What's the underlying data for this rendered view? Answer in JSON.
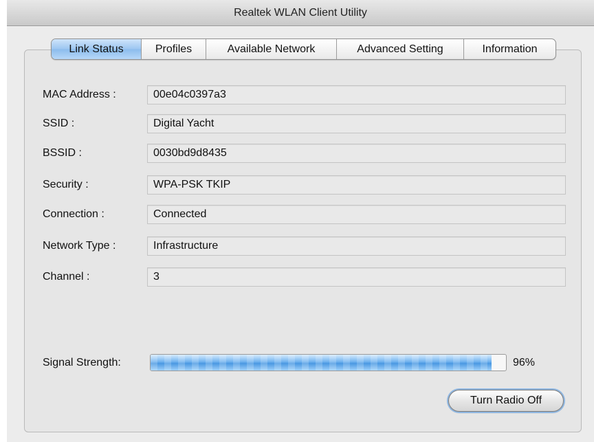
{
  "window": {
    "title": "Realtek WLAN Client Utility"
  },
  "tabs": [
    {
      "label": "Link Status",
      "active": true
    },
    {
      "label": "Profiles",
      "active": false
    },
    {
      "label": "Available Network",
      "active": false
    },
    {
      "label": "Advanced Setting",
      "active": false
    },
    {
      "label": "Information",
      "active": false
    }
  ],
  "link_status": {
    "rows": [
      {
        "label": "MAC Address :",
        "value": "00e04c0397a3"
      },
      {
        "label": "SSID :",
        "value": "Digital Yacht"
      },
      {
        "label": "BSSID :",
        "value": "0030bd9d8435"
      },
      {
        "label": "Security :",
        "value": "WPA-PSK TKIP"
      },
      {
        "label": "Connection :",
        "value": "Connected"
      },
      {
        "label": "Network Type :",
        "value": "Infrastructure"
      },
      {
        "label": "Channel :",
        "value": "3"
      }
    ],
    "signal": {
      "label": "Signal Strength:",
      "percent_text": "96%",
      "level": 0.96
    },
    "radio_button_label": "Turn Radio Off"
  },
  "colors": {
    "active_tab": "#9cc6f1",
    "signal_fill": "#4a98e2"
  }
}
